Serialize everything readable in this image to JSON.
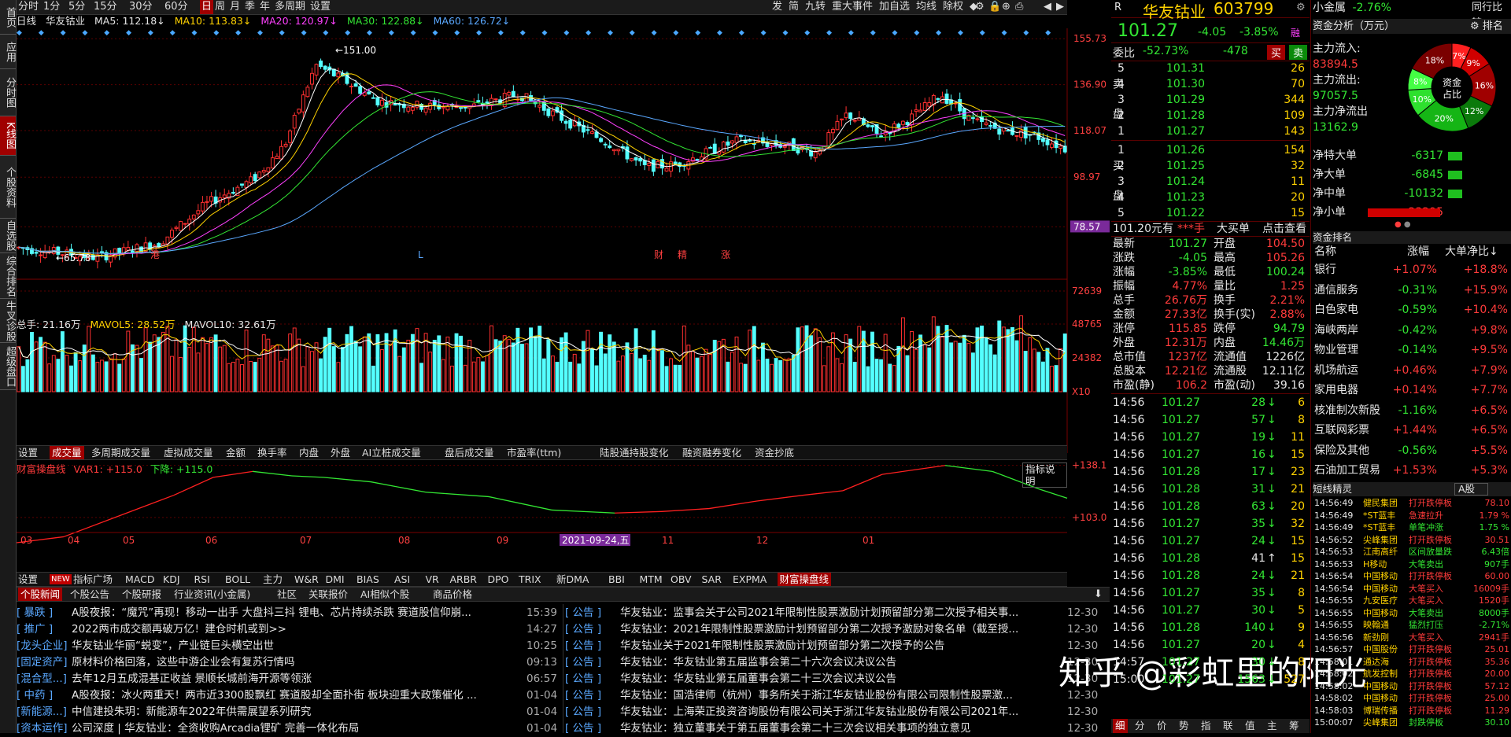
{
  "left_tabs": [
    "首页",
    "应用",
    "分时图",
    "K线图",
    "个股资料",
    "自选股",
    "综合排名",
    "牛叉诊股",
    "超级盘口"
  ],
  "toolbar": {
    "periods": [
      "分时",
      "1分",
      "5分",
      "15分",
      "30分",
      "60分",
      "日",
      "周",
      "月",
      "季",
      "年",
      "多周期",
      "设置"
    ],
    "selected_period": "日",
    "right_items": [
      "发",
      "简",
      "九转",
      "重大事件",
      "加自选",
      "均线",
      "除权",
      "◆"
    ]
  },
  "ma_line": {
    "label": "日线",
    "name": "华友钴业",
    "ma5": "MA5: 112.18",
    "ma10": "MA10: 113.83",
    "ma20": "MA20: 120.97",
    "ma30": "MA30: 122.88",
    "ma60": "MA60: 126.72"
  },
  "k_axis": [
    "155.73",
    "136.90",
    "118.07",
    "98.97",
    "78.57"
  ],
  "k_marks": {
    "high": "151.00",
    "low": "65.78"
  },
  "k_events": [
    "港",
    "L",
    "财",
    "精",
    "涨"
  ],
  "vol_line": {
    "total": "总手: 21.16万",
    "mavol5": "MAVOL5: 28.52万",
    "mavol10": "MAVOL10: 32.61万"
  },
  "vol_axis": [
    "72639",
    "48765",
    "24382",
    "X10"
  ],
  "ind_tabs": [
    "设置",
    "成交量",
    "多周期成交量",
    "虚拟成交量",
    "金额",
    "换手率",
    "内盘",
    "外盘",
    "AI立桩成交量",
    "盘后成交量",
    "市盈率(ttm)",
    "陆股通持股变化",
    "融资融券变化",
    "资金抄底"
  ],
  "ind_tabs_selected": "成交量",
  "fc_line": {
    "name": "财富操盘线",
    "var1": "VAR1: +115.0",
    "down": "下降: +115.0",
    "explain": "指标说明"
  },
  "fc_axis": [
    "+138.1",
    "+103.0"
  ],
  "date_axis": [
    "03",
    "04",
    "05",
    "06",
    "07",
    "08",
    "09",
    "10",
    "11",
    "12",
    "01"
  ],
  "date_cursor": "2021-09-24,五",
  "bottom_tabs": [
    "设置",
    "NEW",
    "指标广场",
    "MACD",
    "KDJ",
    "RSI",
    "BOLL",
    "主力",
    "W&R",
    "DMI",
    "BIAS",
    "ASI",
    "VR",
    "ARBR",
    "DPO",
    "TRIX",
    "新DMA",
    "BBI",
    "MTM",
    "OBV",
    "SAR",
    "EXPMA",
    "财富操盘线"
  ],
  "news_tabs": [
    "个股新闻",
    "个股公告",
    "个股研报",
    "行业资讯(小金属)",
    "社区",
    "关联报价",
    "AI相似个股",
    "商品价格"
  ],
  "news_left": [
    {
      "tag": "[ 暴跌 ]",
      "title": "A股夜报：“魔咒”再现！移动一出手 大盘抖三抖 锂电、芯片持续杀跌 赛道股信仰崩...",
      "time": "15:39"
    },
    {
      "tag": "[ 推广 ]",
      "title": "2022两市成交额再破万亿！建仓时机或到>>",
      "time": "14:27"
    },
    {
      "tag": "[龙头企业]",
      "title": "华友钴业华丽“蜕变”，产业链巨头横空出世",
      "time": "10:25"
    },
    {
      "tag": "[固定资产]",
      "title": "原材料价格回落，这些中游企业会有复苏行情吗",
      "time": "09:13"
    },
    {
      "tag": "[混合型...]",
      "title": "去年12月五成混基正收益 景顺长城前海开源等领涨",
      "time": "06:57"
    },
    {
      "tag": "[ 中药 ]",
      "title": "A股夜报：冰火两重天！两市近3300股飘红 赛道股却全面扑街 板块迎重大政策催化 ...",
      "time": "01-04"
    },
    {
      "tag": "[新能源...]",
      "title": "中信建投朱玥：新能源车2022年供需展望系列研究",
      "time": "01-04"
    },
    {
      "tag": "[资本运作]",
      "title": "公司深度 | 华友钴业：全资收购Arcadia锂矿 完善一体化布局",
      "time": "01-04"
    }
  ],
  "news_right": [
    {
      "tag": "[ 公告 ]",
      "title": "华友钴业：监事会关于公司2021年限制性股票激励计划预留部分第二次授予相关事...",
      "time": "12-30"
    },
    {
      "tag": "[ 公告 ]",
      "title": "华友钴业：2021年限制性股票激励计划预留部分第二次授予激励对象名单（截至授...",
      "time": "12-30"
    },
    {
      "tag": "[ 公告 ]",
      "title": "华友钴业关于2021年限制性股票激励计划预留部分第二次授予的公告",
      "time": "12-30"
    },
    {
      "tag": "[ 公告 ]",
      "title": "华友钴业：华友钴业第五届监事会第二十六次会议决议公告",
      "time": "12-30"
    },
    {
      "tag": "[ 公告 ]",
      "title": "华友钴业：华友钴业第五届董事会第二十三次会议决议公告",
      "time": "12-30"
    },
    {
      "tag": "[ 公告 ]",
      "title": "华友钴业：国浩律师（杭州）事务所关于浙江华友钴业股份有限公司限制性股票激...",
      "time": "12-30"
    },
    {
      "tag": "[ 公告 ]",
      "title": "华友钴业：上海荣正投资咨询股份有限公司关于浙江华友钴业股份有限公司2021年...",
      "time": "12-30"
    },
    {
      "tag": "[ 公告 ]",
      "title": "华友钴业：独立董事关于第五届董事会第二十三次会议相关事项的独立意见",
      "time": "12-30"
    }
  ],
  "quote": {
    "code_label": "R",
    "name": "华友钴业",
    "code": "603799",
    "price": "101.27",
    "change": "-4.05",
    "pct": "-3.85%",
    "tag": "融",
    "weibi": "委比",
    "weibi_pct": "-52.73%",
    "weibi_diff": "-478",
    "buy": "买",
    "sell": "卖"
  },
  "sell_orders": [
    [
      "5",
      "101.31",
      "26"
    ],
    [
      "4",
      "101.30",
      "70"
    ],
    [
      "3",
      "101.29",
      "344"
    ],
    [
      "2",
      "101.28",
      "109"
    ],
    [
      "1",
      "101.27",
      "143"
    ]
  ],
  "buy_orders": [
    [
      "1",
      "101.26",
      "154"
    ],
    [
      "2",
      "101.25",
      "32"
    ],
    [
      "3",
      "101.24",
      "11"
    ],
    [
      "4",
      "101.23",
      "20"
    ],
    [
      "5",
      "101.22",
      "15"
    ]
  ],
  "sell_label": [
    "卖",
    "盘"
  ],
  "buy_label": [
    "买",
    "盘"
  ],
  "big_order": {
    "price": "101.20元有",
    "stars": "***手",
    "label": "大买单",
    "link": "点击查看"
  },
  "stats": [
    [
      "最新",
      "101.27",
      "开盘",
      "104.50"
    ],
    [
      "涨跌",
      "-4.05",
      "最高",
      "105.26"
    ],
    [
      "涨幅",
      "-3.85%",
      "最低",
      "100.24"
    ],
    [
      "振幅",
      "4.77%",
      "量比",
      "1.25"
    ],
    [
      "总手",
      "26.76万",
      "换手",
      "2.21%"
    ],
    [
      "金额",
      "27.33亿",
      "换手(实)",
      "2.88%"
    ],
    [
      "涨停",
      "115.85",
      "跌停",
      "94.79"
    ],
    [
      "外盘",
      "12.31万",
      "内盘",
      "14.46万"
    ],
    [
      "总市值",
      "1237亿",
      "流通值",
      "1226亿"
    ],
    [
      "总股本",
      "12.21亿",
      "流通股",
      "12.11亿"
    ],
    [
      "市盈(静)",
      "106.2",
      "市盈(动)",
      "39.16"
    ]
  ],
  "ticks": [
    [
      "14:56",
      "101.27",
      "28",
      "down",
      "6"
    ],
    [
      "14:56",
      "101.27",
      "57",
      "down",
      "8"
    ],
    [
      "14:56",
      "101.27",
      "19",
      "down",
      "11"
    ],
    [
      "14:56",
      "101.27",
      "16",
      "down",
      "15"
    ],
    [
      "14:56",
      "101.28",
      "17",
      "down",
      "23"
    ],
    [
      "14:56",
      "101.28",
      "31",
      "down",
      "21"
    ],
    [
      "14:56",
      "101.28",
      "63",
      "down",
      "20"
    ],
    [
      "14:56",
      "101.27",
      "35",
      "down",
      "32"
    ],
    [
      "14:56",
      "101.27",
      "24",
      "down",
      "15"
    ],
    [
      "14:56",
      "101.28",
      "41",
      "up",
      "15"
    ],
    [
      "14:56",
      "101.28",
      "24",
      "down",
      "21"
    ],
    [
      "14:56",
      "101.27",
      "35",
      "down",
      "8"
    ],
    [
      "14:56",
      "101.27",
      "30",
      "down",
      "5"
    ],
    [
      "14:56",
      "101.28",
      "140",
      "down",
      "9"
    ],
    [
      "14:56",
      "101.27",
      "20",
      "down",
      "4"
    ],
    [
      "14:57",
      "101.27",
      "30",
      "down",
      "8"
    ],
    [
      "15:00",
      "101.27",
      "1563",
      "down",
      "527"
    ]
  ],
  "tick_tabs": [
    "细",
    "分",
    "价",
    "势",
    "指",
    "联",
    "值",
    "主",
    "筹"
  ],
  "sector": {
    "name": "小金属",
    "pct": "-2.76%",
    "right": "同行比较"
  },
  "fund": {
    "title": "资金分析（万元）",
    "right": "排名",
    "in_label": "主力流入:",
    "in": "83894.5",
    "out_label": "主力流出:",
    "out": "97057.5",
    "net_label": "主力净流出",
    "net": "13162.9",
    "pie_center": [
      "资金",
      "占比"
    ],
    "pie": [
      {
        "label": "7%",
        "value": 7,
        "color": "#ff2020"
      },
      {
        "label": "9%",
        "value": 9,
        "color": "#d00000"
      },
      {
        "label": "16%",
        "value": 16,
        "color": "#a00000"
      },
      {
        "label": "12%",
        "value": 12,
        "color": "#0b7a0b"
      },
      {
        "label": "20%",
        "value": 20,
        "color": "#15b515"
      },
      {
        "label": "10%",
        "value": 10,
        "color": "#2ee02e"
      },
      {
        "label": "8%",
        "value": 8,
        "color": "#44ff44"
      },
      {
        "label": "18%",
        "value": 18,
        "color": "#7a0000"
      }
    ],
    "bars": [
      [
        "净特大单",
        "-6317",
        "green",
        0.27
      ],
      [
        "净大单",
        "-6845",
        "green",
        0.29
      ],
      [
        "净中单",
        "-10132",
        "green",
        0.44
      ],
      [
        "净小单",
        "23295",
        "red",
        1.0
      ]
    ]
  },
  "rank": {
    "title": "资金排名",
    "headers": [
      "名称",
      "涨幅",
      "大单净比"
    ],
    "rows": [
      [
        "银行",
        "+1.07%",
        "+18.8%"
      ],
      [
        "通信服务",
        "-0.31%",
        "+15.9%"
      ],
      [
        "白色家电",
        "-0.59%",
        "+10.4%"
      ],
      [
        "海峡两岸",
        "-0.42%",
        "+9.8%"
      ],
      [
        "物业管理",
        "-0.14%",
        "+9.5%"
      ],
      [
        "机场航运",
        "+0.46%",
        "+7.9%"
      ],
      [
        "家用电器",
        "+0.14%",
        "+7.7%"
      ],
      [
        "核准制次新股",
        "-1.16%",
        "+6.5%"
      ],
      [
        "互联网彩票",
        "+1.44%",
        "+6.5%"
      ],
      [
        "保险及其他",
        "-0.56%",
        "+5.5%"
      ],
      [
        "石油加工贸易",
        "+1.53%",
        "+5.3%"
      ]
    ]
  },
  "sprite": {
    "title": "短线精灵",
    "market": "A股",
    "rows": [
      [
        "14:56:49",
        "健民集团",
        "打开跌停板",
        "78.10"
      ],
      [
        "14:56:49",
        "*ST蓝丰",
        "急速拉升",
        "1.79 %"
      ],
      [
        "14:56:49",
        "*ST蓝丰",
        "单笔冲涨",
        "1.75 %"
      ],
      [
        "14:56:52",
        "尖峰集团",
        "打开跌停板",
        "30.51"
      ],
      [
        "14:56:53",
        "江南高纤",
        "区间放量跌",
        "6.43倍"
      ],
      [
        "14:56:53",
        "H移动",
        "大笔卖出",
        "907手"
      ],
      [
        "14:56:54",
        "中国移动",
        "打开跌停板",
        "60.00"
      ],
      [
        "14:56:54",
        "中国移动",
        "大笔买入",
        "16009手"
      ],
      [
        "14:56:55",
        "九安医疗",
        "大笔买入",
        "1520手"
      ],
      [
        "14:56:55",
        "中国移动",
        "大笔卖出",
        "8000手"
      ],
      [
        "14:56:55",
        "映翰通",
        "猛烈打压",
        "-2.71%"
      ],
      [
        "14:56:56",
        "新劲刚",
        "大笔买入",
        "2941手"
      ],
      [
        "14:56:57",
        "中国股份",
        "打开跌停板",
        "25.01"
      ],
      [
        "14:58:01",
        "通达海",
        "打开跌停板",
        "35.36"
      ],
      [
        "14:58:02",
        "航发控制",
        "打开跌停板",
        "20.00"
      ],
      [
        "14:58:02",
        "中国移动",
        "打开跌停板",
        "57.12"
      ],
      [
        "14:58:02",
        "中国移动",
        "打开跌停板",
        "25.00"
      ],
      [
        "14:58:03",
        "博瑞传播",
        "打开跌停板",
        "11.29"
      ],
      [
        "15:00:07",
        "尖峰集团",
        "封跌停板",
        "30.10"
      ]
    ]
  },
  "watermark": "知乎 @彩虹里的阳光"
}
